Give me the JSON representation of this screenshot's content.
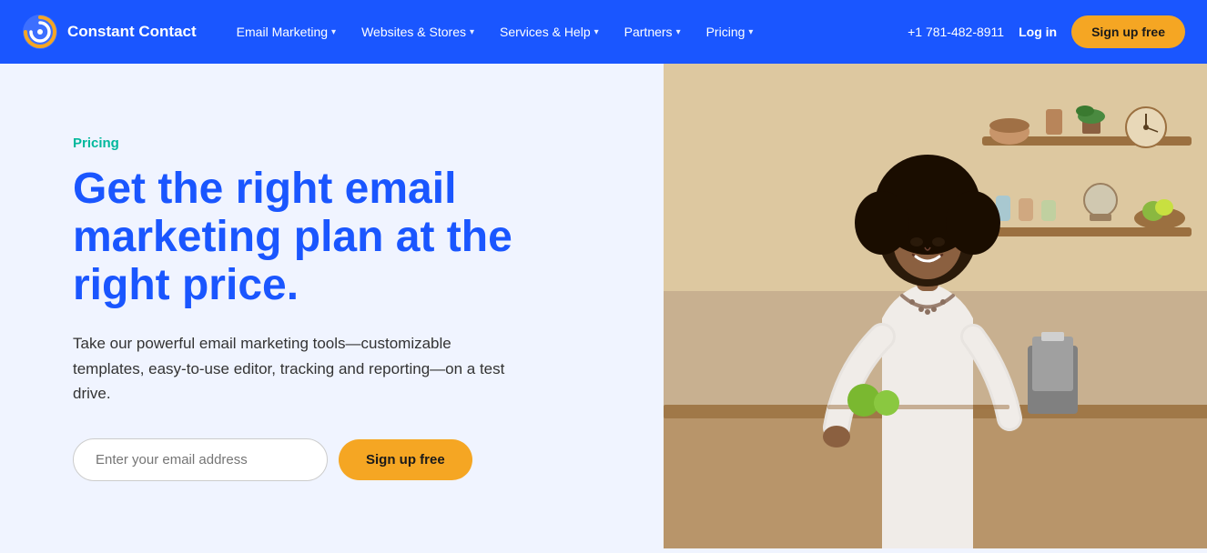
{
  "nav": {
    "logo_text": "Constant Contact",
    "links": [
      {
        "label": "Email Marketing",
        "has_dropdown": true
      },
      {
        "label": "Websites & Stores",
        "has_dropdown": true
      },
      {
        "label": "Services & Help",
        "has_dropdown": true
      },
      {
        "label": "Partners",
        "has_dropdown": true
      },
      {
        "label": "Pricing",
        "has_dropdown": true
      }
    ],
    "phone": "+1 781-482-8911",
    "login": "Log in",
    "signup": "Sign up free"
  },
  "hero": {
    "label": "Pricing",
    "title": "Get the right email marketing plan at the right price.",
    "description": "Take our powerful email marketing tools—customizable templates, easy-to-use editor, tracking and reporting—on a test drive.",
    "email_placeholder": "Enter your email address",
    "signup_btn": "Sign up free"
  },
  "colors": {
    "nav_bg": "#1a56ff",
    "hero_bg": "#f0f4ff",
    "accent_green": "#00b89c",
    "accent_blue": "#1a56ff",
    "accent_orange": "#f5a623"
  }
}
